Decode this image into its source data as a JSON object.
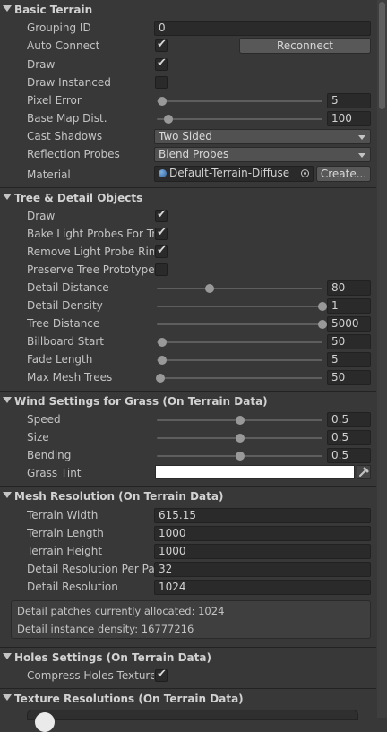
{
  "basic_terrain": {
    "title": "Basic Terrain",
    "grouping_id": {
      "label": "Grouping ID",
      "value": "0"
    },
    "auto_connect": {
      "label": "Auto Connect",
      "checked": true
    },
    "reconnect_button": "Reconnect",
    "draw": {
      "label": "Draw",
      "checked": true
    },
    "draw_instanced": {
      "label": "Draw Instanced",
      "checked": false
    },
    "pixel_error": {
      "label": "Pixel Error",
      "value": "5",
      "fraction": 0.03
    },
    "base_map_dist": {
      "label": "Base Map Dist.",
      "value": "100",
      "fraction": 0.07
    },
    "cast_shadows": {
      "label": "Cast Shadows",
      "value": "Two Sided"
    },
    "reflection_probes": {
      "label": "Reflection Probes",
      "value": "Blend Probes"
    },
    "material": {
      "label": "Material",
      "value": "Default-Terrain-Diffuse",
      "create_button": "Create..."
    }
  },
  "tree_detail": {
    "title": "Tree & Detail Objects",
    "draw": {
      "label": "Draw",
      "checked": true
    },
    "bake_light_probes": {
      "label": "Bake Light Probes For Trees",
      "checked": true
    },
    "remove_light_probe_ring": {
      "label": "Remove Light Probe Ring",
      "checked": true
    },
    "preserve_tree_prototype": {
      "label": "Preserve Tree Prototype",
      "checked": false
    },
    "detail_distance": {
      "label": "Detail Distance",
      "value": "80",
      "fraction": 0.32
    },
    "detail_density": {
      "label": "Detail Density",
      "value": "1",
      "fraction": 1.0
    },
    "tree_distance": {
      "label": "Tree Distance",
      "value": "5000",
      "fraction": 1.0
    },
    "billboard_start": {
      "label": "Billboard Start",
      "value": "50",
      "fraction": 0.03
    },
    "fade_length": {
      "label": "Fade Length",
      "value": "5",
      "fraction": 0.03
    },
    "max_mesh_trees": {
      "label": "Max Mesh Trees",
      "value": "50",
      "fraction": 0.02
    }
  },
  "wind": {
    "title": "Wind Settings for Grass (On Terrain Data)",
    "speed": {
      "label": "Speed",
      "value": "0.5",
      "fraction": 0.5
    },
    "size": {
      "label": "Size",
      "value": "0.5",
      "fraction": 0.5
    },
    "bending": {
      "label": "Bending",
      "value": "0.5",
      "fraction": 0.5
    },
    "grass_tint": {
      "label": "Grass Tint",
      "color": "#ffffff"
    }
  },
  "mesh_resolution": {
    "title": "Mesh Resolution (On Terrain Data)",
    "terrain_width": {
      "label": "Terrain Width",
      "value": "615.15"
    },
    "terrain_length": {
      "label": "Terrain Length",
      "value": "1000"
    },
    "terrain_height": {
      "label": "Terrain Height",
      "value": "1000"
    },
    "detail_res_per_patch": {
      "label": "Detail Resolution Per Patch",
      "value": "32"
    },
    "detail_resolution": {
      "label": "Detail Resolution",
      "value": "1024"
    },
    "info_line1": "Detail patches currently allocated: 1024",
    "info_line2": "Detail instance density: 16777216"
  },
  "holes": {
    "title": "Holes Settings (On Terrain Data)",
    "compress_holes_texture": {
      "label": "Compress Holes Texture",
      "checked": true
    }
  },
  "texture_resolutions": {
    "title": "Texture Resolutions (On Terrain Data)"
  },
  "icons": {
    "section_arrow": "triangle-down-icon",
    "checkmark": "checkmark-icon",
    "dropdown_caret": "caret-down-icon",
    "object_picker": "target-icon",
    "eyedropper": "eyedropper-icon"
  }
}
